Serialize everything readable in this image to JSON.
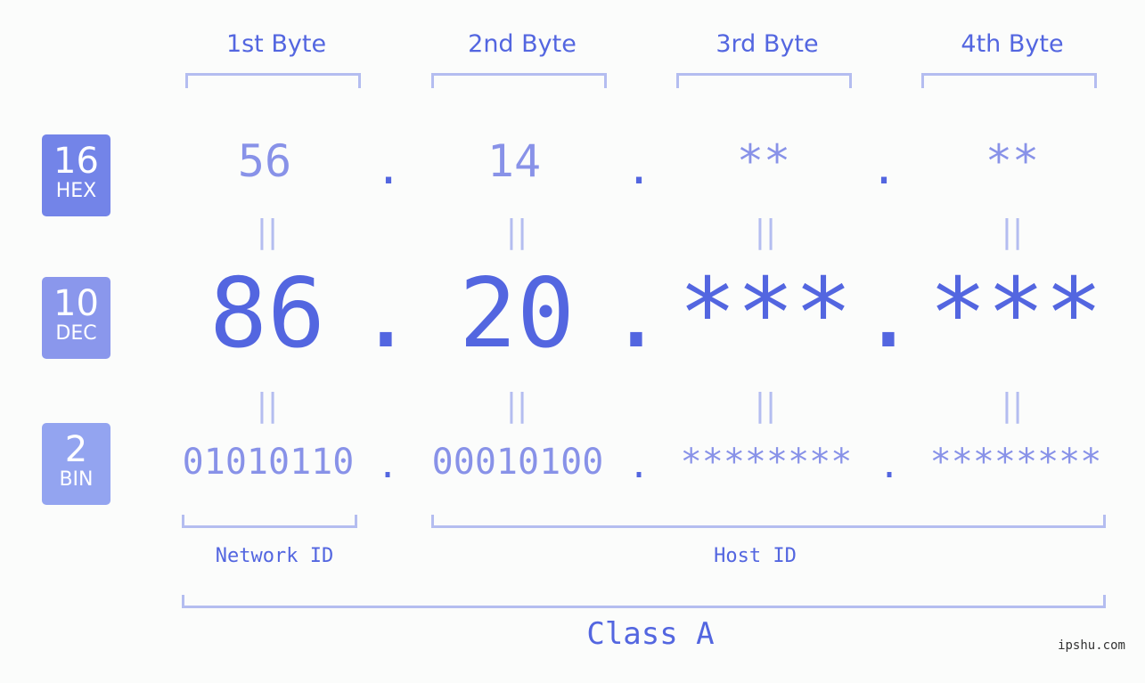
{
  "bytes": [
    "1st Byte",
    "2nd Byte",
    "3rd Byte",
    "4th Byte"
  ],
  "badges": [
    {
      "number": "16",
      "label": "HEX",
      "color": "#7384e8"
    },
    {
      "number": "10",
      "label": "DEC",
      "color": "#8a97ec"
    },
    {
      "number": "2",
      "label": "BIN",
      "color": "#93a4f0"
    }
  ],
  "hex": [
    "56",
    "14",
    "**",
    "**"
  ],
  "dec": [
    "86",
    "20",
    "***",
    "***"
  ],
  "bin": [
    "01010110",
    "00010100",
    "********",
    "********"
  ],
  "separator": ".",
  "equals": "||",
  "network_label": "Network ID",
  "host_label": "Host ID",
  "class_label": "Class A",
  "watermark": "ipshu.com"
}
